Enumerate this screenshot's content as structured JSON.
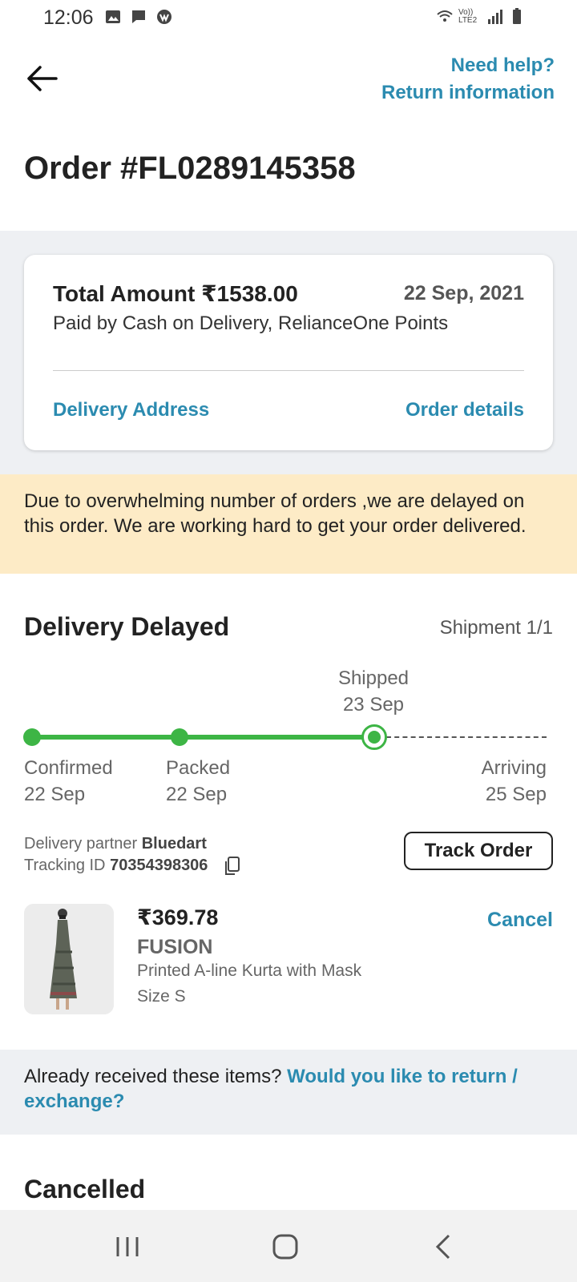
{
  "status_bar": {
    "time": "12:06",
    "icons": [
      "gallery-icon",
      "message-icon",
      "app-icon",
      "wifi-icon",
      "volte-icon",
      "signal-icon",
      "battery-icon"
    ],
    "volte_text": "Vo)) LTE2"
  },
  "header": {
    "need_help": "Need help?",
    "return_info": "Return information"
  },
  "order": {
    "title": "Order #FL0289145358",
    "total": "Total Amount ₹1538.00",
    "date": "22 Sep, 2021",
    "paid_by": "Paid by Cash on Delivery, RelianceOne Points",
    "delivery_address": "Delivery Address",
    "order_details": "Order details"
  },
  "banner": {
    "text": "Due to overwhelming number of orders ,we are delayed on this order. We are working hard to get your order delivered."
  },
  "shipment": {
    "status_title": "Delivery Delayed",
    "count": "Shipment 1/1",
    "progress_fraction": 0.7,
    "stages": {
      "confirmed": {
        "label": "Confirmed",
        "date": "22 Sep"
      },
      "packed": {
        "label": "Packed",
        "date": "22 Sep"
      },
      "shipped": {
        "label": "Shipped",
        "date": "23 Sep"
      },
      "arriving": {
        "label": "Arriving",
        "date": "25 Sep"
      }
    },
    "partner_label": "Delivery partner",
    "partner_name": "Bluedart",
    "tracking_label": "Tracking ID",
    "tracking_id": "70354398306",
    "track_button": "Track Order"
  },
  "product": {
    "price": "₹369.78",
    "brand": "FUSION",
    "name": "Printed A-line Kurta with Mask",
    "size": "Size S",
    "cancel": "Cancel"
  },
  "return_prompt": {
    "text": "Already received these items?",
    "link": "Would you like to return / exchange?"
  },
  "cancelled": {
    "title": "Cancelled"
  },
  "colors": {
    "accent": "#2b8bb0",
    "progress": "#3db545",
    "banner_bg": "#fdebc6",
    "section_bg": "#eef0f3"
  }
}
